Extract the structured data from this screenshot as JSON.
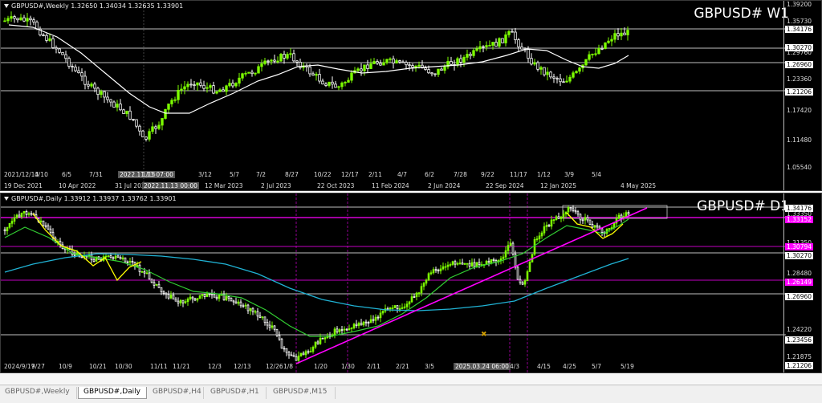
{
  "weekly": {
    "info_line": "GBPUSD#,Weekly  1.32650 1.34034 1.32635 1.33901",
    "watermark": "GBPUSD# W1",
    "price_labels": [
      "1.39200",
      "1.35730",
      "1.34176",
      "1.30270",
      "1.29760",
      "1.26960",
      "1.23360",
      "1.21206",
      "1.17420",
      "1.11480",
      "1.05540"
    ],
    "highlight_prices": [
      "1.34176",
      "1.30270",
      "1.26960",
      "1.21206"
    ],
    "top_price": "1.39200",
    "time_labels": [
      "2021/12/13",
      "4/10",
      "6/5",
      "7/31",
      "2022.11.13 07:00",
      "1/15",
      "3/12",
      "5/7",
      "7/2",
      "8/27",
      "10/22",
      "12/17",
      "2/11",
      "4/7",
      "6/2",
      "7/28",
      "9/22",
      "11/17",
      "1/12",
      "3/9",
      "5/4"
    ],
    "time_labels_bottom": [
      "19 Dec 2021",
      "10 Apr 2022",
      "31 Jul 2022",
      "2022.11.13 00:00",
      "12 Mar 2023",
      "2 Jul 2023",
      "22 Oct 2023",
      "11 Feb 2024",
      "2 Jun 2024",
      "22 Sep 2024",
      "12 Jan 2025",
      "4 May 2025"
    ]
  },
  "daily": {
    "info_line": "GBPUSD#,Daily  1.33912 1.33937 1.33762 1.33901",
    "watermark": "GBPUSD# D1",
    "price_labels": [
      "1.34176",
      "1.33350",
      "1.33152",
      "1.31350",
      "1.30794",
      "1.30270",
      "1.28480",
      "1.26149",
      "1.26960",
      "1.24220",
      "1.23456",
      "1.21875",
      "1.21206"
    ],
    "time_labels": [
      "2024/9/17",
      "9/27",
      "10/9",
      "10/21",
      "10/30",
      "11/11",
      "11/21",
      "12/3",
      "12/13",
      "12/26",
      "1/8",
      "1/20",
      "1/30",
      "2/11",
      "2/21",
      "3/5",
      "2025.03.24 06:00",
      "4/3",
      "4/15",
      "4/25",
      "5/7",
      "5/19"
    ],
    "time_labels_bottom": [
      "17 Sep 2024",
      "9 Oct 2024",
      "30 Oct 2024",
      "21 Nov 2024",
      "13 Dec 2024",
      "8 Jan 2025",
      "30 Jan 2025",
      "21 Feb 2025",
      "2025.03.24 00:00",
      "3 Apr 2025",
      "25 Apr 2025",
      "19 May 2025"
    ]
  },
  "tabs": [
    "GBPUSD#,Weekly",
    "GBPUSD#,Daily",
    "GBPUSD#,H4",
    "GBPUSD#,H1",
    "GBPUSD#,M15"
  ],
  "active_tab": 1,
  "colors": {
    "up": "#7cfc00",
    "down": "#ffffff",
    "ma_white": "#ffffff",
    "ma_green": "#32cd32",
    "ma_cyan": "#20b2d4",
    "ma_yellow": "#ffff00",
    "trend": "#ff00ff",
    "level": "#ffffff"
  }
}
